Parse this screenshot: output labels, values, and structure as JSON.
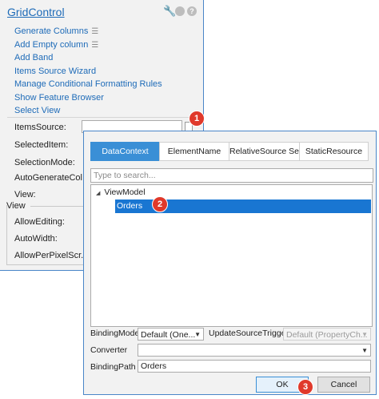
{
  "panel": {
    "title": "GridControl",
    "icons": [
      "wrench-icon",
      "gear-icon",
      "help-icon"
    ],
    "links": [
      {
        "label": "Generate Columns",
        "pinned": true
      },
      {
        "label": "Add Empty column",
        "pinned": true
      },
      {
        "label": "Add Band",
        "pinned": false
      },
      {
        "label": "Items Source Wizard",
        "pinned": false
      },
      {
        "label": "Manage Conditional Formatting Rules",
        "pinned": false
      },
      {
        "label": "Show Feature Browser",
        "pinned": false
      },
      {
        "label": "Select View",
        "pinned": false
      }
    ],
    "properties": [
      "ItemsSource:",
      "SelectedItem:",
      "SelectionMode:",
      "AutoGenerateCol...",
      "View:"
    ],
    "view_section": {
      "title": "View",
      "properties": [
        "AllowEditing:",
        "AutoWidth:",
        "AllowPerPixelScr..."
      ]
    }
  },
  "popup": {
    "tabs": [
      "DataContext",
      "ElementName",
      "RelativeSource Self",
      "StaticResource"
    ],
    "active_tab": "DataContext",
    "search_placeholder": "Type to search...",
    "tree": {
      "root": "ViewModel",
      "selected": "Orders"
    },
    "binding_mode_label": "BindingMode",
    "binding_mode_value": "Default (One...",
    "update_trigger_label": "UpdateSourceTrigger",
    "update_trigger_value": "Default (PropertyCh...",
    "converter_label": "Converter",
    "converter_value": "",
    "binding_path_label": "BindingPath",
    "binding_path_value": "Orders",
    "ok_label": "OK",
    "cancel_label": "Cancel"
  },
  "badges": [
    "1",
    "2",
    "3"
  ],
  "colors": {
    "accent": "#3a8fd6",
    "selection": "#1976d2",
    "link": "#1e6bb8",
    "badge": "#e0392b"
  }
}
